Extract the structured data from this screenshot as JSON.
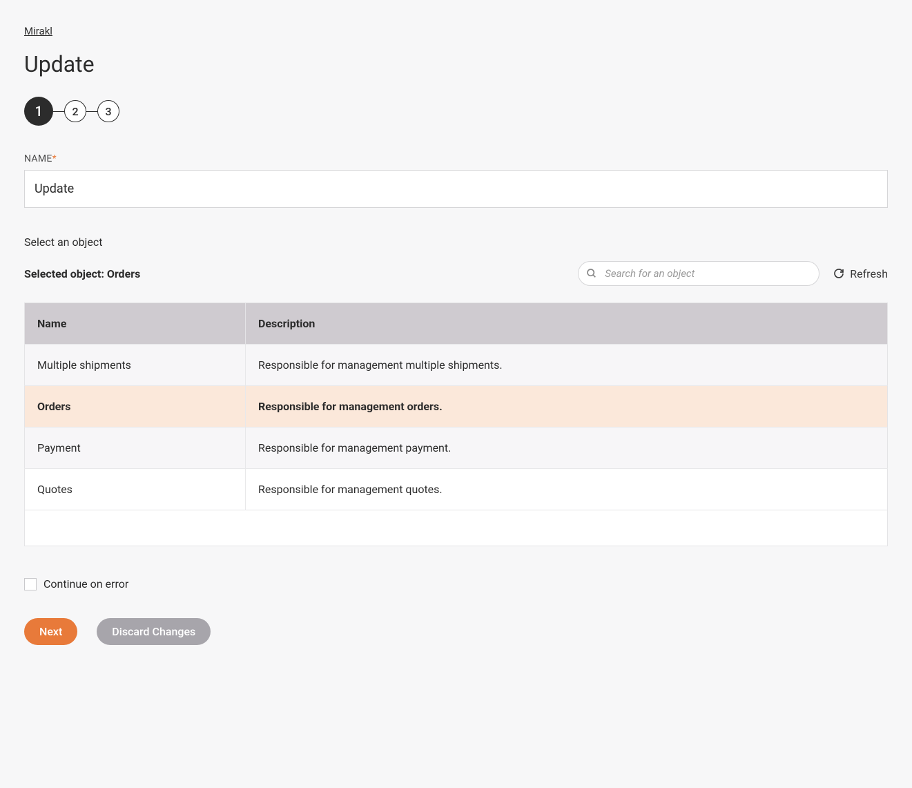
{
  "breadcrumb": "Mirakl",
  "page_title": "Update",
  "stepper": {
    "steps": [
      "1",
      "2",
      "3"
    ],
    "active": 0
  },
  "name_field": {
    "label": "NAME",
    "value": "Update"
  },
  "select_heading": "Select an object",
  "selected_object_prefix": "Selected object: ",
  "selected_object_value": "Orders",
  "search": {
    "placeholder": "Search for an object"
  },
  "refresh_label": "Refresh",
  "table": {
    "headers": {
      "name": "Name",
      "description": "Description"
    },
    "rows": [
      {
        "name": "Multiple shipments",
        "description": "Responsible for management multiple shipments.",
        "selected": false
      },
      {
        "name": "Orders",
        "description": "Responsible for management orders.",
        "selected": true
      },
      {
        "name": "Payment",
        "description": "Responsible for management payment.",
        "selected": false
      },
      {
        "name": "Quotes",
        "description": "Responsible for management quotes.",
        "selected": false
      }
    ]
  },
  "continue_on_error_label": "Continue on error",
  "continue_on_error_checked": false,
  "buttons": {
    "next": "Next",
    "discard": "Discard Changes"
  }
}
